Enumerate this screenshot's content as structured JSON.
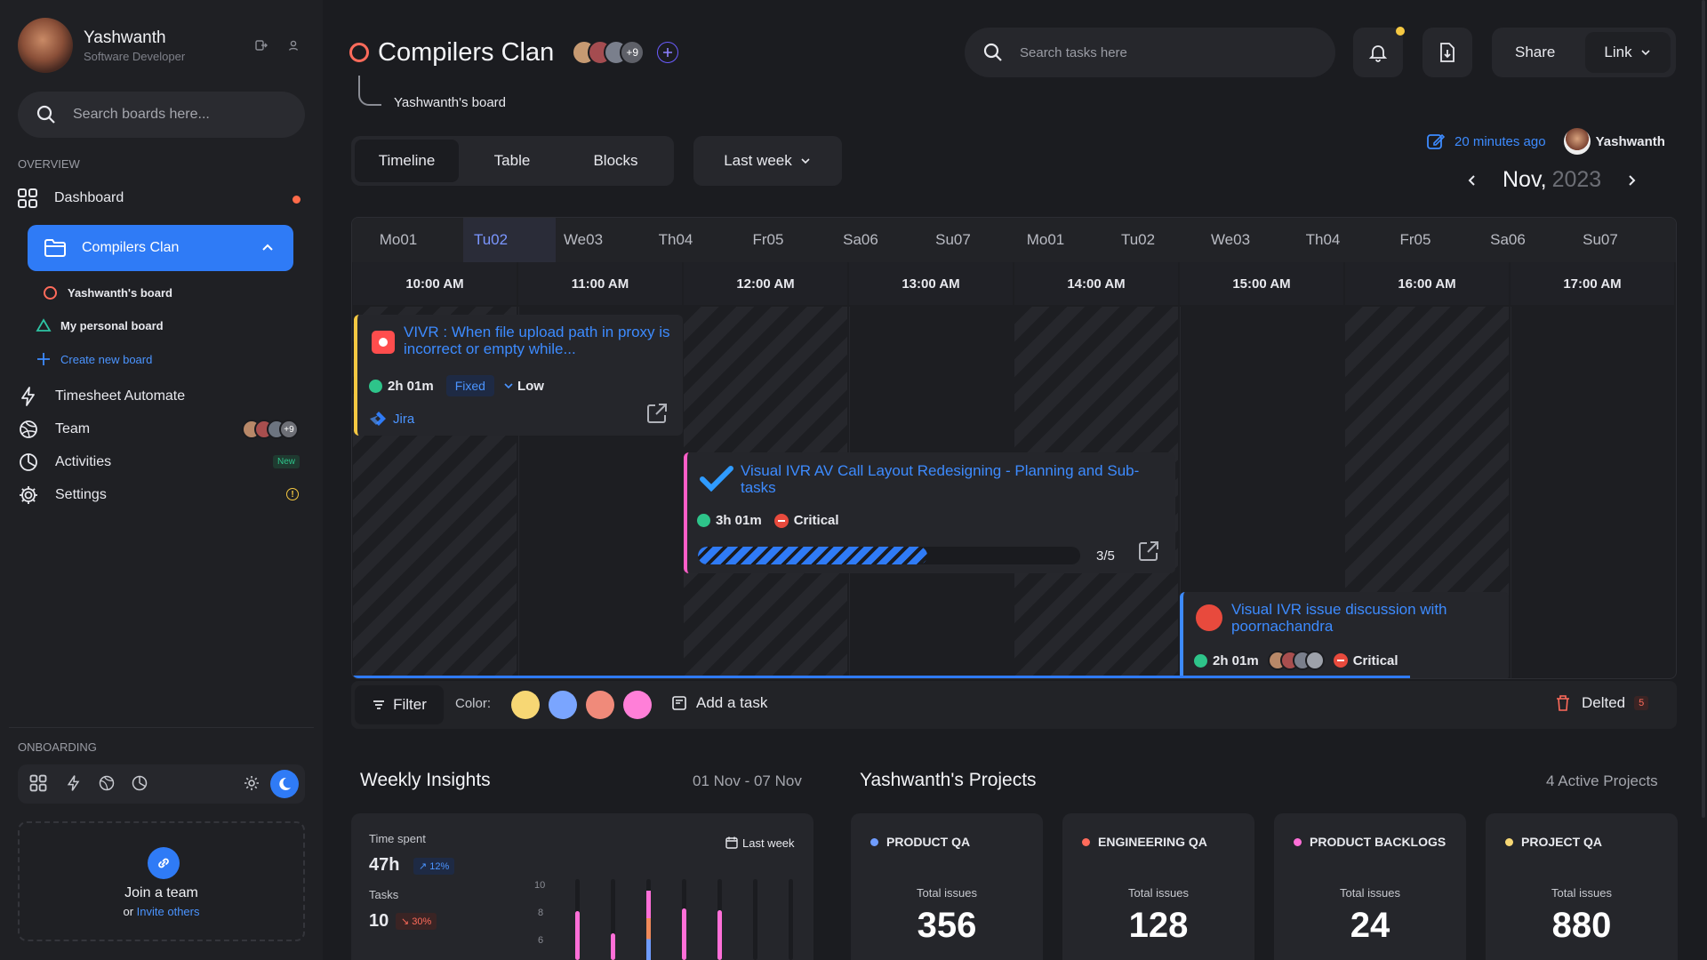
{
  "user": {
    "name": "Yashwanth",
    "role": "Software Developer"
  },
  "sidebar": {
    "search_placeholder": "Search boards here...",
    "overview_label": "OVERVIEW",
    "dashboard_label": "Dashboard",
    "active_board": "Compilers Clan",
    "sub_boards": [
      "Yashwanth's board",
      "My personal board"
    ],
    "create_board": "Create new board",
    "items": [
      {
        "label": "Timesheet Automate"
      },
      {
        "label": "Team",
        "badge": "+9"
      },
      {
        "label": "Activities",
        "badge": "New"
      },
      {
        "label": "Settings"
      }
    ],
    "onboarding_label": "ONBOARDING",
    "join_title": "Join a team",
    "join_or": "or",
    "join_link": "Invite others"
  },
  "header": {
    "title": "Compilers Clan",
    "members_more": "+9",
    "breadcrumb": "Yashwanth's board",
    "search_placeholder": "Search tasks here",
    "share_label": "Share",
    "link_label": "Link"
  },
  "view": {
    "tabs": [
      "Timeline",
      "Table",
      "Blocks"
    ],
    "active_tab": "Timeline",
    "range": "Last week",
    "edited": "20 minutes ago",
    "editor": "Yashwanth",
    "month": "Nov,",
    "year": "2023"
  },
  "timeline": {
    "days": [
      "Mo01",
      "Tu02",
      "We03",
      "Th04",
      "Fr05",
      "Sa06",
      "Su07",
      "Mo01",
      "Tu02",
      "We03",
      "Th04",
      "Fr05",
      "Sa06",
      "Su07"
    ],
    "times": [
      "10:00 AM",
      "11:00 AM",
      "12:00 AM",
      "13:00 AM",
      "14:00 AM",
      "15:00 AM",
      "16:00 AM",
      "17:00 AM"
    ],
    "tasks": [
      {
        "title": "VIVR : When file upload path in proxy is incorrect or empty while...",
        "duration": "2h 01m",
        "status": "Fixed",
        "priority": "Low",
        "source": "Jira",
        "accent": "#f5c842"
      },
      {
        "title": "Visual IVR AV Call Layout Redesigning - Planning and Sub-tasks",
        "duration": "3h 01m",
        "priority": "Critical",
        "progress": "3/5",
        "progress_fraction": 0.6,
        "accent": "#ff5ec8"
      },
      {
        "title": "Visual IVR issue discussion with poornachandra",
        "duration": "2h 01m",
        "priority": "Critical",
        "accent": "#3d8bff"
      }
    ]
  },
  "toolbar": {
    "filter": "Filter",
    "color_label": "Color:",
    "colors": [
      "#f7d774",
      "#7aa5ff",
      "#f08a7a",
      "#ff7fd8"
    ],
    "add_task": "Add a task",
    "deleted_label": "Delted",
    "deleted_count": "5"
  },
  "insights": {
    "title": "Weekly Insights",
    "range": "01 Nov - 07 Nov",
    "time_label": "Time spent",
    "time_value": "47h",
    "time_change": "12%",
    "tasks_label": "Tasks",
    "tasks_value": "10",
    "tasks_change": "30%",
    "period": "Last week",
    "y_ticks": [
      "10",
      "8",
      "6"
    ]
  },
  "projects": {
    "title": "Yashwanth's Projects",
    "active": "4 Active Projects",
    "items": [
      {
        "name": "PRODUCT QA",
        "label": "Total issues",
        "value": "356",
        "color": "#6f9cff"
      },
      {
        "name": "ENGINEERING QA",
        "label": "Total issues",
        "value": "128",
        "color": "#ff6b5b"
      },
      {
        "name": "PRODUCT BACKLOGS",
        "label": "Total issues",
        "value": "24",
        "color": "#ff6fd8"
      },
      {
        "name": "PROJECT QA",
        "label": "Total issues",
        "value": "880",
        "color": "#f7d774"
      }
    ]
  }
}
